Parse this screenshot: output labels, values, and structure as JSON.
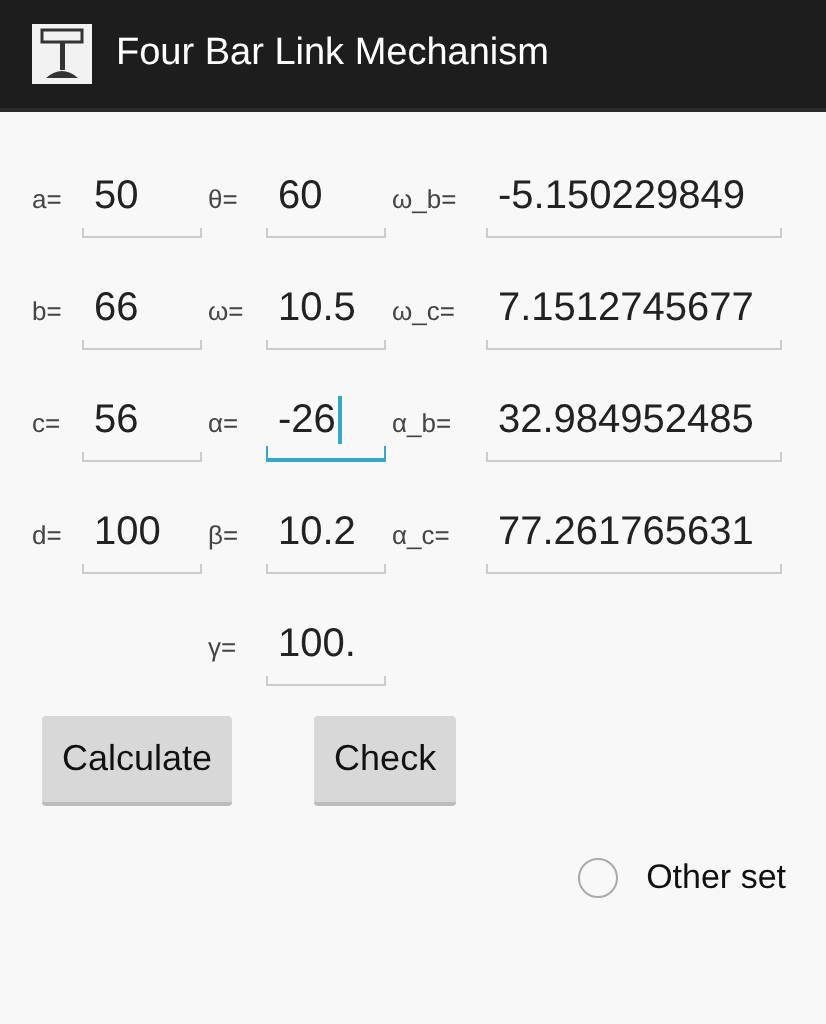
{
  "window": {
    "title": "Four Bar Link Mechanism"
  },
  "rows": [
    [
      {
        "label": "a=",
        "value": "50",
        "focused": false
      },
      {
        "label": "θ=",
        "value": "60",
        "focused": false
      },
      {
        "label": "ω_b=",
        "value": "-5.150229849",
        "focused": false
      }
    ],
    [
      {
        "label": "b=",
        "value": "66",
        "focused": false
      },
      {
        "label": "ω=",
        "value": "10.5",
        "focused": false
      },
      {
        "label": "ω_c=",
        "value": "7.1512745677",
        "focused": false
      }
    ],
    [
      {
        "label": "c=",
        "value": "56",
        "focused": false
      },
      {
        "label": "α=",
        "value": "-26",
        "focused": true
      },
      {
        "label": "α_b=",
        "value": "32.984952485",
        "focused": false
      }
    ],
    [
      {
        "label": "d=",
        "value": "100",
        "focused": false
      },
      {
        "label": "β=",
        "value": "10.2",
        "focused": false
      },
      {
        "label": "α_c=",
        "value": "77.261765631",
        "focused": false
      }
    ],
    [
      null,
      {
        "label": "γ=",
        "value": "100.",
        "focused": false
      },
      null
    ]
  ],
  "buttons": [
    "Calculate",
    "Check"
  ],
  "option": {
    "label": "Other set",
    "checked": false
  }
}
